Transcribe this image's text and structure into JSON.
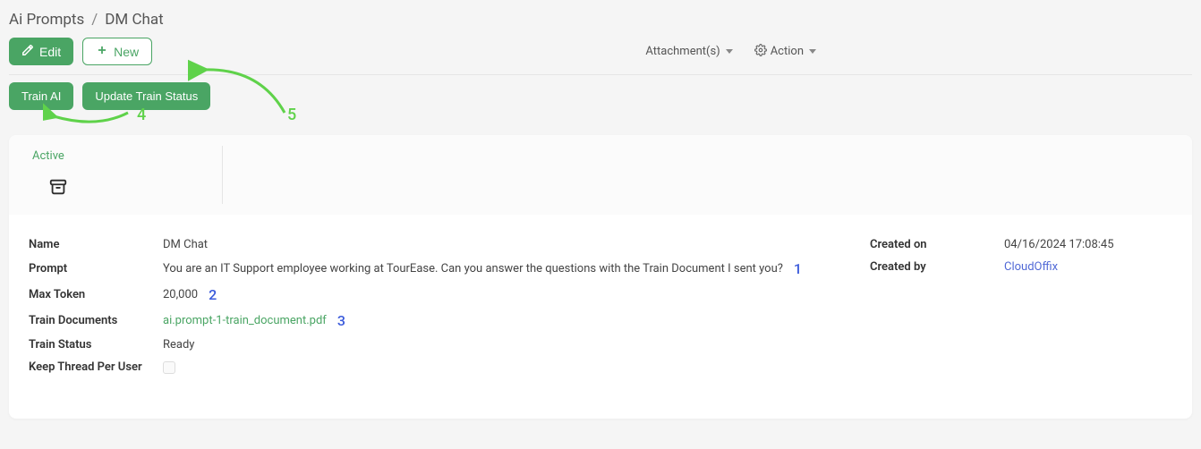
{
  "breadcrumb": {
    "parent": "Ai Prompts",
    "separator": "/",
    "current": "DM Chat"
  },
  "toolbar": {
    "edit_label": "Edit",
    "new_label": "New",
    "attachments_label": "Attachment(s)",
    "action_label": "Action"
  },
  "action_buttons": {
    "train_ai": "Train AI",
    "update_train_status": "Update Train Status"
  },
  "status": {
    "active": "Active"
  },
  "annotations": {
    "a1": "1",
    "a2": "2",
    "a3": "3",
    "a4": "4",
    "a5": "5"
  },
  "fields": {
    "name": {
      "label": "Name",
      "value": "DM Chat"
    },
    "prompt": {
      "label": "Prompt",
      "value": " You are an IT Support employee working at TourEase.  Can you answer the questions with the Train Document I sent you?"
    },
    "max_token": {
      "label": "Max Token",
      "value": "20,000"
    },
    "train_documents": {
      "label": "Train Documents",
      "value": "ai.prompt-1-train_document.pdf"
    },
    "train_status": {
      "label": "Train Status",
      "value": "Ready"
    },
    "keep_thread": {
      "label": "Keep Thread Per User"
    },
    "created_on": {
      "label": "Created on",
      "value": "04/16/2024 17:08:45"
    },
    "created_by": {
      "label": "Created by",
      "value": "CloudOffix"
    }
  }
}
